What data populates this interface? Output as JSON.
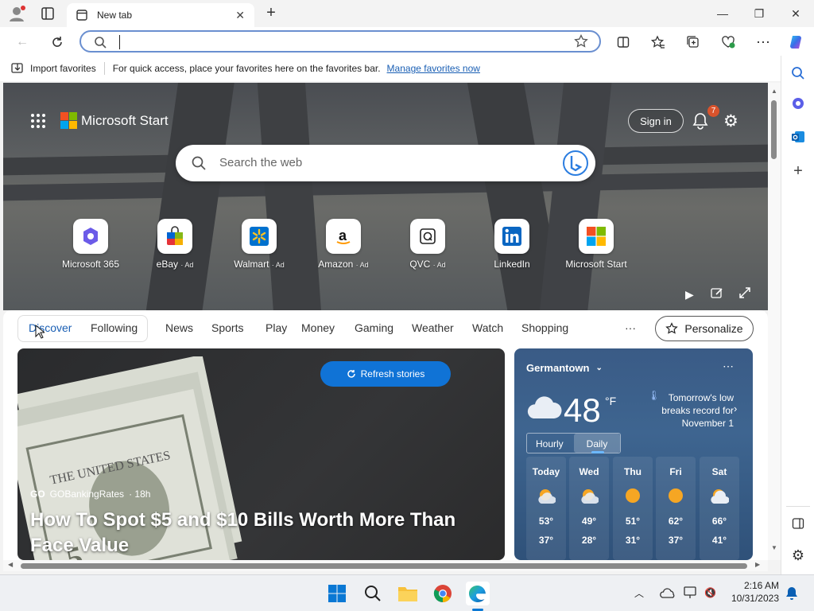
{
  "browser": {
    "tab_title": "New tab",
    "address_value": "",
    "favorites_bar": {
      "import_label": "Import favorites",
      "message": "For quick access, place your favorites here on the favorites bar.",
      "manage_link": "Manage favorites now"
    }
  },
  "start": {
    "brand": "Microsoft Start",
    "sign_in": "Sign in",
    "notification_count": "7",
    "search_placeholder": "Search the web",
    "quick_links": [
      {
        "label": "Microsoft 365",
        "ad": ""
      },
      {
        "label": "eBay",
        "ad": "· Ad"
      },
      {
        "label": "Walmart",
        "ad": "· Ad"
      },
      {
        "label": "Amazon",
        "ad": "· Ad"
      },
      {
        "label": "QVC",
        "ad": "· Ad"
      },
      {
        "label": "LinkedIn",
        "ad": ""
      },
      {
        "label": "Microsoft Start",
        "ad": ""
      }
    ],
    "feed_tabs": [
      "Discover",
      "Following",
      "News",
      "Sports",
      "Play",
      "Money",
      "Gaming",
      "Weather",
      "Watch",
      "Shopping"
    ],
    "more": "···",
    "personalize": "Personalize",
    "refresh_label": "Refresh stories",
    "story": {
      "source": "GOBankingRates",
      "age": "· 18h",
      "headline": "How To Spot $5 and $10 Bills Worth More Than Face Value"
    },
    "weather": {
      "location": "Germantown",
      "temperature": "48",
      "unit": "°F",
      "alert": "Tomorrow's low breaks record for November 1",
      "tabs": [
        "Hourly",
        "Daily"
      ],
      "days": [
        {
          "day": "Today",
          "high": "53°",
          "low": "37°",
          "icon": "partly-sunny-icon"
        },
        {
          "day": "Wed",
          "high": "49°",
          "low": "28°",
          "icon": "partly-sunny-icon"
        },
        {
          "day": "Thu",
          "high": "51°",
          "low": "31°",
          "icon": "sunny-icon"
        },
        {
          "day": "Fri",
          "high": "62°",
          "low": "37°",
          "icon": "sunny-icon"
        },
        {
          "day": "Sat",
          "high": "66°",
          "low": "41°",
          "icon": "partly-cloudy-icon"
        }
      ]
    }
  },
  "taskbar": {
    "time": "2:16 AM",
    "date": "10/31/2023"
  },
  "colors": {
    "accent": "#1073d6",
    "weather_bg": "#3a5b86",
    "link": "#1a5fb4"
  }
}
